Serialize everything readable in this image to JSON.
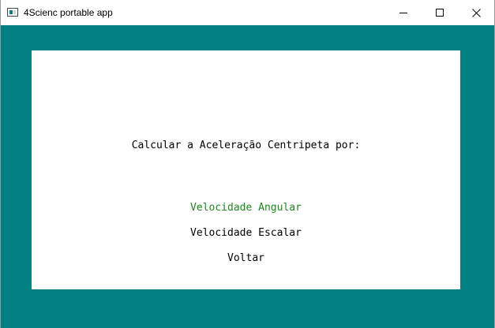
{
  "window": {
    "title": "4Scienc portable app",
    "controls": {
      "minimize": "minimize-icon",
      "maximize": "maximize-icon",
      "close": "close-icon"
    }
  },
  "colors": {
    "background": "#008080",
    "panel": "#ffffff",
    "selected_option": "#1a8a1a",
    "text": "#000000"
  },
  "menu": {
    "heading": "Calcular a Aceleração Centripeta por:",
    "options": [
      {
        "label": "Velocidade Angular",
        "selected": true
      },
      {
        "label": "Velocidade Escalar",
        "selected": false
      },
      {
        "label": "Voltar",
        "selected": false
      }
    ]
  }
}
